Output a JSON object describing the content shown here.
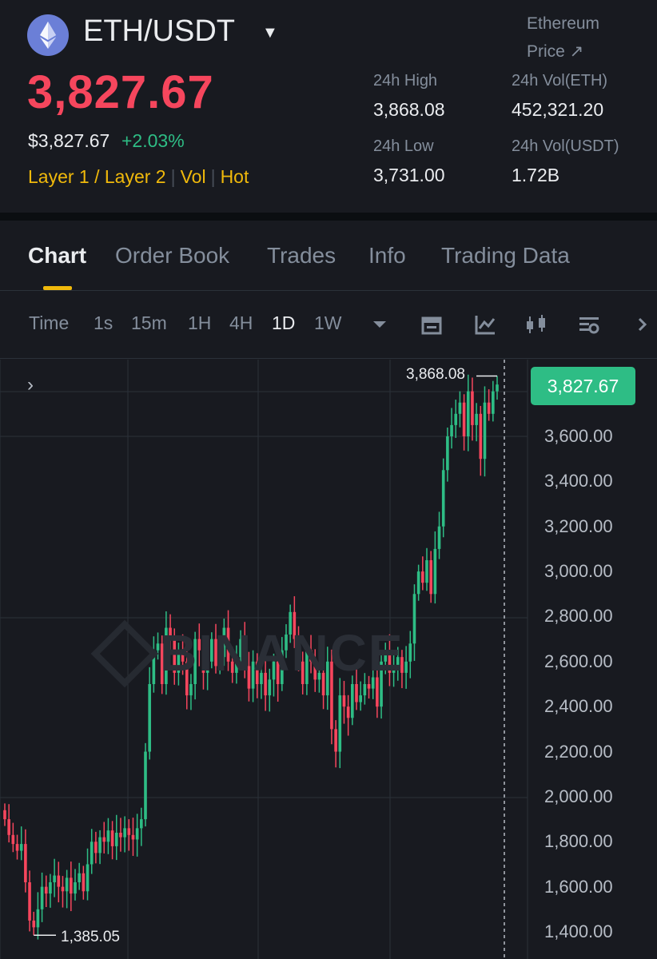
{
  "header": {
    "pair": "ETH/USDT",
    "link_line1": "Ethereum",
    "link_line2": "Price ↗",
    "price": "3,827.67",
    "price_usd": "$3,827.67",
    "change": "+2.03%",
    "tags": [
      "Layer 1 / Layer 2",
      "Vol",
      "Hot"
    ],
    "stats": {
      "high_label": "24h High",
      "high_value": "3,868.08",
      "low_label": "24h Low",
      "low_value": "3,731.00",
      "vol_eth_label": "24h Vol(ETH)",
      "vol_eth_value": "452,321.20",
      "vol_usdt_label": "24h Vol(USDT)",
      "vol_usdt_value": "1.72B"
    },
    "colors": {
      "down": "#f6465d",
      "up": "#2ebd85",
      "accent": "#f0b90b"
    }
  },
  "tabs": [
    {
      "label": "Chart",
      "active": true
    },
    {
      "label": "Order Book"
    },
    {
      "label": "Trades"
    },
    {
      "label": "Info"
    },
    {
      "label": "Trading Data"
    }
  ],
  "toolbar": {
    "intervals": [
      "Time",
      "1s",
      "15m",
      "1H",
      "4H",
      "1D",
      "1W"
    ],
    "active": "1D",
    "icons": [
      "chevron-down-icon",
      "calendar-icon",
      "indicator-icon",
      "candle-style-icon",
      "settings-icon",
      "chevron-right-icon"
    ]
  },
  "chart": {
    "watermark": "BINANCE",
    "last_price": "3,827.67",
    "high_marker": "3,868.08",
    "low_marker": "1,385.05",
    "y_ticks": [
      "3,600.00",
      "3,400.00",
      "3,200.00",
      "3,000.00",
      "2,800.00",
      "2,600.00",
      "2,400.00",
      "2,200.00",
      "2,000.00",
      "1,800.00",
      "1,600.00",
      "1,400.00"
    ]
  },
  "chart_data": {
    "type": "candlestick",
    "interval": "1D",
    "ylim": [
      1300,
      3950
    ],
    "grid": true,
    "high": 3868.08,
    "low": 1385.05,
    "last": 3827.67,
    "closes": [
      1900,
      1830,
      1790,
      1760,
      1790,
      1620,
      1450,
      1420,
      1500,
      1600,
      1570,
      1620,
      1650,
      1600,
      1580,
      1640,
      1570,
      1620,
      1660,
      1580,
      1700,
      1800,
      1750,
      1820,
      1800,
      1850,
      1780,
      1840,
      1820,
      1860,
      1830,
      1810,
      1860,
      1900,
      2200,
      2500,
      2650,
      2680,
      2500,
      2750,
      2700,
      2550,
      2650,
      2600,
      2450,
      2500,
      2700,
      2650,
      2550,
      2600,
      2700,
      2580,
      2620,
      2750,
      2600,
      2550,
      2620,
      2700,
      2580,
      2480,
      2600,
      2500,
      2550,
      2450,
      2520,
      2600,
      2500,
      2650,
      2720,
      2820,
      2700,
      2600,
      2500,
      2650,
      2600,
      2520,
      2550,
      2450,
      2600,
      2300,
      2200,
      2450,
      2400,
      2350,
      2500,
      2420,
      2450,
      2500,
      2480,
      2530,
      2400,
      2600,
      2650,
      2550,
      2580,
      2620,
      2550,
      2600,
      2680,
      2900,
      3000,
      2950,
      3050,
      2900,
      3100,
      3200,
      3450,
      3600,
      3650,
      3700,
      3750,
      3600,
      3800,
      3650,
      3700,
      3500,
      3750,
      3700,
      3800,
      3830
    ]
  }
}
